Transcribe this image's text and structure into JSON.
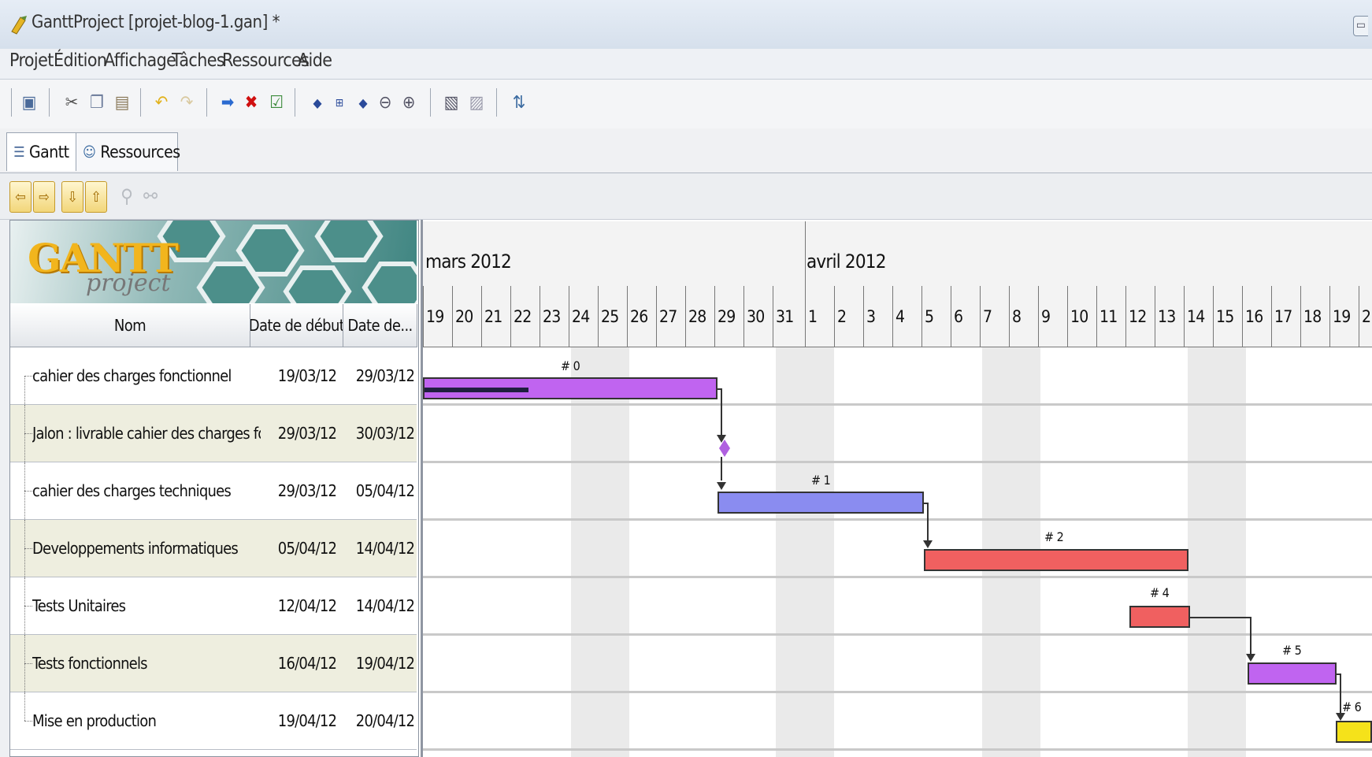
{
  "window": {
    "title": "GanttProject [projet-blog-1.gan] *"
  },
  "menu": [
    "Projet",
    "Édition",
    "Affichage",
    "Tâches",
    "Ressources",
    "Aide"
  ],
  "tabs": [
    {
      "label": "Gantt",
      "active": true
    },
    {
      "label": "Ressources",
      "active": false
    }
  ],
  "logo": {
    "main": "GANTT",
    "sub": "project"
  },
  "table": {
    "headers": [
      "Nom",
      "Date de début",
      "Date de..."
    ],
    "rows": [
      {
        "name": "cahier des charges fonctionnel",
        "start": "19/03/12",
        "end": "29/03/12"
      },
      {
        "name": "Jalon : livrable cahier des charges fon...",
        "start": "29/03/12",
        "end": "30/03/12"
      },
      {
        "name": "cahier des charges techniques",
        "start": "29/03/12",
        "end": "05/04/12"
      },
      {
        "name": "Developpements informatiques",
        "start": "05/04/12",
        "end": "14/04/12"
      },
      {
        "name": "Tests Unitaires",
        "start": "12/04/12",
        "end": "14/04/12"
      },
      {
        "name": "Tests fonctionnels",
        "start": "16/04/12",
        "end": "19/04/12"
      },
      {
        "name": "Mise en production",
        "start": "19/04/12",
        "end": "20/04/12"
      }
    ]
  },
  "timeline": {
    "months": [
      "mars 2012",
      "avril 2012"
    ],
    "days": [
      "19",
      "20",
      "21",
      "22",
      "23",
      "24",
      "25",
      "26",
      "27",
      "28",
      "29",
      "30",
      "31",
      "1",
      "2",
      "3",
      "4",
      "5",
      "6",
      "7",
      "8",
      "9",
      "10",
      "11",
      "12",
      "13",
      "14",
      "15",
      "16",
      "17",
      "18",
      "19",
      "2"
    ]
  },
  "bars": [
    {
      "label": "# 0",
      "color": "#c064f0"
    },
    {
      "label": "# 1",
      "color": "#8a8cf0"
    },
    {
      "label": "# 2",
      "color": "#f06060"
    },
    {
      "label": "# 4",
      "color": "#f06060"
    },
    {
      "label": "# 5",
      "color": "#c064f0"
    },
    {
      "label": "# 6",
      "color": "#f5e21a"
    }
  ],
  "colors": {
    "milestone": "#b060e0",
    "title_bg": "#dde6f1"
  }
}
